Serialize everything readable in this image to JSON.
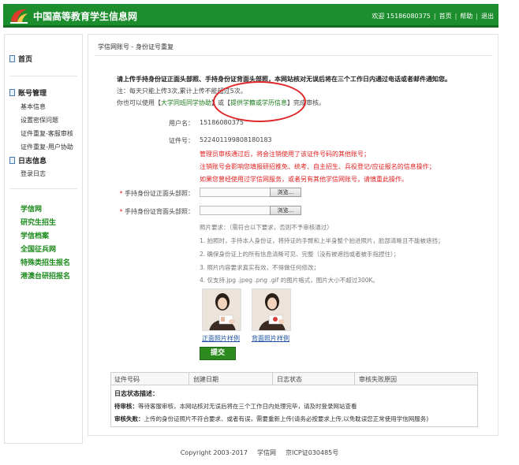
{
  "header": {
    "site_title": "中国高等教育学生信息网",
    "welcome": "欢迎 15186080375",
    "nav_home": "首页",
    "nav_help": "帮助",
    "nav_logout": "退出",
    "bg_color": "#1d8e2e"
  },
  "sidebar": {
    "home": "首页",
    "account_title": "账号管理",
    "account_items": [
      "基本信息",
      "设置密保问题",
      "证件重复-客服审核",
      "证件重复-用户协助"
    ],
    "log_title": "日志信息",
    "log_items": [
      "登录日志"
    ],
    "links": [
      "学信网",
      "研究生招生",
      "学信档案",
      "全国征兵网",
      "特殊类招生报名",
      "港澳台研招报名"
    ]
  },
  "main": {
    "breadcrumb": "学信网账号 - 身份证号重复",
    "intro": "请上传手持身份证正面头部照、手持身份证背面头部照，本网站核对无误后将在三个工作日内通过电话或者邮件通知您。",
    "note": "注：每天只能上传3次,累计上传不能超过5次。",
    "alt_prefix": "你也可以使用【",
    "alt_link1": "大学同班同学协助",
    "alt_mid": "】或【",
    "alt_link2": "提供学籍或学历信息",
    "alt_suffix": "】完成审核。",
    "username_label": "用户名：",
    "username_value": "15186080375",
    "idnum_label": "证件号：",
    "idnum_value": "522401199808180183",
    "warnings": [
      "管理员审核通过后，将会注销使用了该证件号码的其他账号；",
      "注销账号会影响您填报研招推免、统考、自主招生、兵役登记/应征报名的信息操作；",
      "如果您曾经使用过学信网服务，或者另有其他学信网账号，请慎重此操作。"
    ],
    "front_label": "手持身份证正面头部照：",
    "back_label": "手持身份证背面头部照：",
    "required_mark": "*",
    "browse_label": "浏览...",
    "requirements": [
      "照片要求：（需符合以下要求，否则不予审核通过）",
      "1. 拍照时，手持本人身份证，将持证的手臂和上半身整个拍进照片，脸部清晰且不能被遮挡；",
      "2. 确保身份证上的所有信息清晰可见、完整（没有被遮挡或者被手指捏住）；",
      "3. 照片内容要求真实有效，不得做任何修改；",
      "4. 仅支持.jpg .jpeg .png .gif 的图片格式，图片大小不超过300K。"
    ],
    "sample_front": "正面照片样例",
    "sample_back": "背面照片样例",
    "submit_label": "提交",
    "submit_color": "#2d8a1f"
  },
  "log_table": {
    "columns": [
      "证件号码",
      "创建日期",
      "日志状态",
      "审核失败原因"
    ],
    "desc_title": "日志状态描述：",
    "pending_label": "待审核：",
    "pending_text": "等待客服审核，本网站核对无误后将在三个工作日内处理完毕，请及时登录网站查看",
    "failed_label": "审核失败：",
    "failed_text": "上传的身份证照片不符合要求、或者有误，需要重新上传(请务必按要求上传,以免耽误您正常使用学信网服务)"
  },
  "footer": {
    "copyright": "Copyright 2003-2017",
    "site": "学信网",
    "icp": "京ICP证030485号"
  }
}
